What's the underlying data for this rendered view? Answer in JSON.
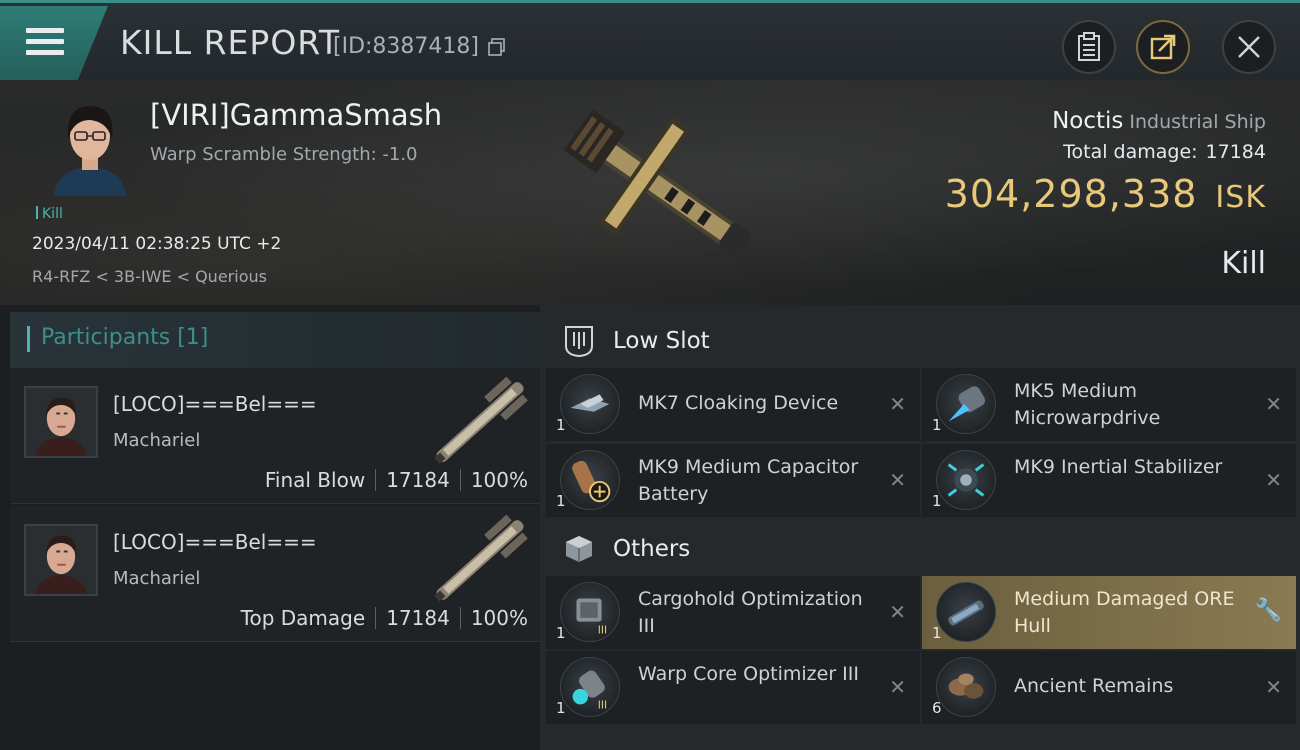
{
  "header": {
    "title": "KILL REPORT",
    "report_id": "[ID:8387418]"
  },
  "victim": {
    "name": "[VIRI]GammaSmash",
    "warp_scramble": "Warp Scramble Strength: -1.0",
    "tag": "Kill",
    "timestamp": "2023/04/11 02:38:25 UTC +2",
    "location": "R4-RFZ < 3B-IWE < Querious"
  },
  "ship": {
    "name": "Noctis",
    "class": "Industrial Ship",
    "damage_label": "Total damage:",
    "damage_value": "17184",
    "isk_value": "304,298,338",
    "isk_unit": "ISK",
    "result": "Kill"
  },
  "participants": {
    "header": "Participants [1]",
    "rows": [
      {
        "name": "[LOCO]===Bel===",
        "ship": "Machariel",
        "role": "Final Blow",
        "damage": "17184",
        "percent": "100%"
      },
      {
        "name": "[LOCO]===Bel===",
        "ship": "Machariel",
        "role": "Top Damage",
        "damage": "17184",
        "percent": "100%"
      }
    ]
  },
  "low_slot": {
    "title": "Low Slot",
    "items": [
      {
        "name": "MK7 Cloaking Device",
        "qty": "1"
      },
      {
        "name": "MK5 Medium Microwarpdrive",
        "qty": "1"
      },
      {
        "name": "MK9 Medium Capacitor Battery",
        "qty": "1"
      },
      {
        "name": "MK9 Inertial Stabilizer",
        "qty": "1"
      }
    ]
  },
  "others": {
    "title": "Others",
    "items": [
      {
        "name": "Cargohold Optimization III",
        "qty": "1"
      },
      {
        "name": "Medium Damaged ORE Hull",
        "qty": "1"
      },
      {
        "name": "Warp Core Optimizer III",
        "qty": "1"
      },
      {
        "name": "Ancient Remains",
        "qty": "6"
      }
    ]
  },
  "colors": {
    "accent_teal": "#4ab4ae",
    "isk_gold": "#e8c97a",
    "highlight_gold": "#8a7a52"
  }
}
